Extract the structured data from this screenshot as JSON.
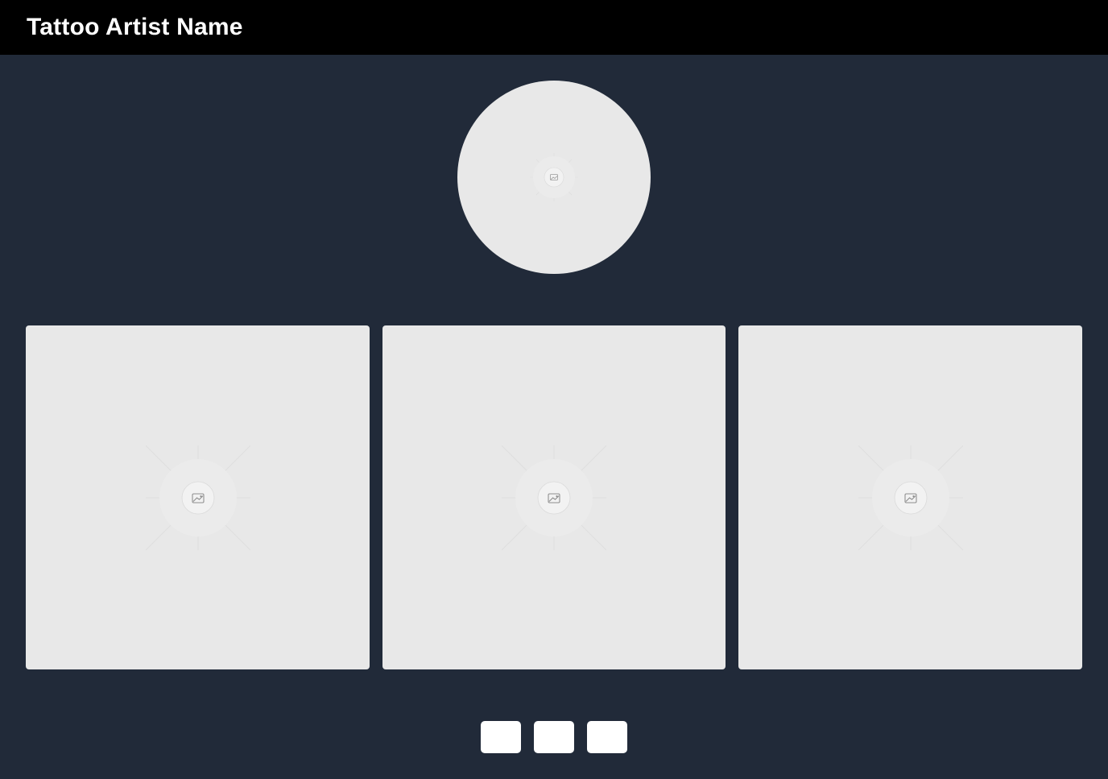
{
  "header": {
    "title": "Tattoo Artist Name"
  },
  "profile": {
    "avatar_icon": "image-placeholder-icon"
  },
  "gallery": {
    "items": [
      {
        "icon": "image-placeholder-icon"
      },
      {
        "icon": "image-placeholder-icon"
      },
      {
        "icon": "image-placeholder-icon"
      }
    ]
  },
  "pagination": {
    "buttons": [
      {
        "label": ""
      },
      {
        "label": ""
      },
      {
        "label": ""
      }
    ]
  },
  "colors": {
    "header_bg": "#000000",
    "page_bg": "#212a39",
    "placeholder_bg": "#e8e8e8",
    "button_bg": "#ffffff",
    "title_text": "#ffffff"
  }
}
